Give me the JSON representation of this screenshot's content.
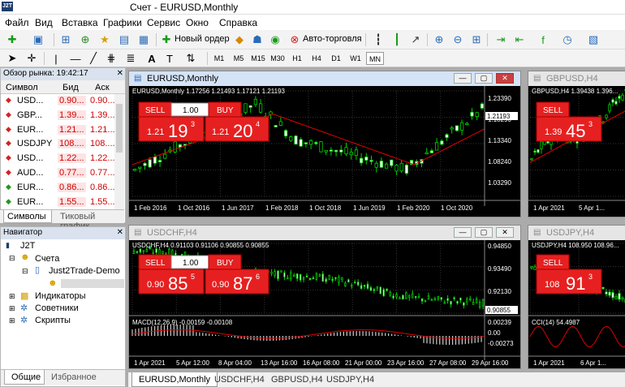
{
  "title": "Счет - EURUSD,Monthly",
  "logo": "J2T",
  "menu": [
    "Файл",
    "Вид",
    "Вставка",
    "Графики",
    "Сервис",
    "Окно",
    "Справка"
  ],
  "toolbar": {
    "new_order": "Новый ордер",
    "auto_trading": "Авто-торговля"
  },
  "timeframes": [
    "M1",
    "M5",
    "M15",
    "M30",
    "H1",
    "H4",
    "D1",
    "W1",
    "MN"
  ],
  "market_watch": {
    "header": "Обзор рынка: 19:42:17",
    "cols": [
      "Символ",
      "Бид",
      "Аск"
    ],
    "rows": [
      {
        "sym": "USD...",
        "bid": "0.90...",
        "ask": "0.90...",
        "dir": "up"
      },
      {
        "sym": "GBP...",
        "bid": "1.39...",
        "ask": "1.39...",
        "dir": "up"
      },
      {
        "sym": "EUR...",
        "bid": "1.21...",
        "ask": "1.21...",
        "dir": "up"
      },
      {
        "sym": "USDJPY",
        "bid": "108....",
        "ask": "108....",
        "dir": "up"
      },
      {
        "sym": "USD...",
        "bid": "1.22...",
        "ask": "1.22...",
        "dir": "up"
      },
      {
        "sym": "AUD...",
        "bid": "0.77...",
        "ask": "0.77...",
        "dir": "up"
      },
      {
        "sym": "EUR...",
        "bid": "0.86...",
        "ask": "0.86...",
        "dir": "down"
      },
      {
        "sym": "EUR...",
        "bid": "1.55...",
        "ask": "1.55...",
        "dir": "down"
      }
    ],
    "tabs": [
      "Символы",
      "Тиковый график"
    ]
  },
  "navigator": {
    "header": "Навигатор",
    "root": "J2T",
    "accounts": "Счета",
    "server": "Just2Trade-Demo",
    "indicators": "Индикаторы",
    "advisors": "Советники",
    "scripts": "Скрипты",
    "tabs": [
      "Общие",
      "Избранное"
    ]
  },
  "charts": {
    "eurusd": {
      "caption": "EURUSD,Monthly",
      "info": "EURUSD,Monthly  1.17256 1.21493 1.17121 1.21193",
      "sell": "SELL",
      "buy": "BUY",
      "qty": "1.00",
      "sell_price": {
        "a": "1.21",
        "b": "19",
        "c": "3"
      },
      "buy_price": {
        "a": "1.21",
        "b": "20",
        "c": "4"
      },
      "y_ticks": [
        "1.23390",
        "1.18290",
        "1.13340",
        "1.08240",
        "1.03290"
      ],
      "current": "1.21193",
      "x_ticks": [
        "1 Feb 2016",
        "1 Oct 2016",
        "1 Jun 2017",
        "1 Feb 2018",
        "1 Oct 2018",
        "1 Jun 2019",
        "1 Feb 2020",
        "1 Oct 2020"
      ]
    },
    "gbpusd": {
      "caption": "GBPUSD,H4",
      "info": "GBPUSD,H4  1.39438 1.396...",
      "sell": "SELL",
      "sell_price": {
        "a": "1.39",
        "b": "45",
        "c": "3"
      },
      "x_ticks": [
        "1 Apr 2021",
        "5 Apr 1..."
      ]
    },
    "usdchf": {
      "caption": "USDCHF,H4",
      "info": "USDCHF,H4  0.91103 0.91106 0.90855 0.90855",
      "sell": "SELL",
      "buy": "BUY",
      "qty": "1.00",
      "sell_price": {
        "a": "0.90",
        "b": "85",
        "c": "5"
      },
      "buy_price": {
        "a": "0.90",
        "b": "87",
        "c": "6"
      },
      "y_ticks": [
        "0.94850",
        "0.93490",
        "0.92130"
      ],
      "current": "0.90855",
      "macd_info": "MACD(12,26,9) -0.00159 -0.00108",
      "macd_ticks": [
        "0.00239",
        "0.00",
        "-0.00273"
      ],
      "x_ticks": [
        "1 Apr 2021",
        "5 Apr 12:00",
        "8 Apr 04:00",
        "13 Apr 16:00",
        "16 Apr 08:00",
        "21 Apr 00:00",
        "23 Apr 16:00",
        "27 Apr 08:00",
        "29 Apr 16:00"
      ]
    },
    "usdjpy": {
      "caption": "USDJPY,H4",
      "info": "USDJPY,H4  108.950 108.96...",
      "sell": "SELL",
      "sell_price": {
        "a": "108",
        "b": "91",
        "c": "3"
      },
      "cci_info": "CCI(14) 54.4987",
      "x_ticks": [
        "1 Apr 2021",
        "6 Apr 1..."
      ]
    }
  },
  "bottom_tabs": [
    "EURUSD,Monthly",
    "USDCHF,H4",
    "GBPUSD,H4",
    "USDJPY,H4"
  ],
  "colors": {
    "up_candle": "#00c800",
    "ma_line": "#e00000",
    "sell_bg": "#e62020"
  }
}
